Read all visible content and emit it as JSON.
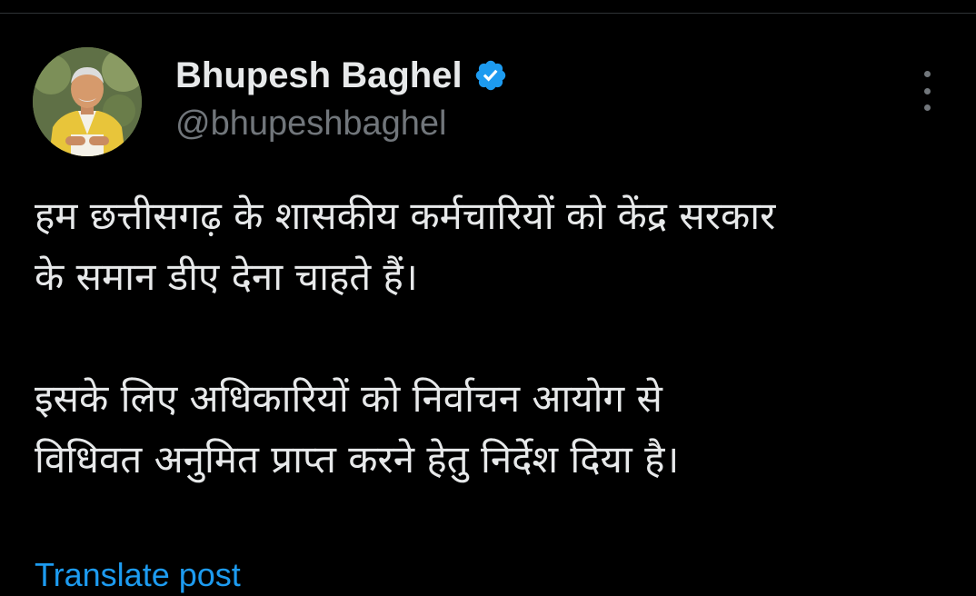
{
  "author": {
    "display_name": "Bhupesh Baghel",
    "handle": "@bhupeshbaghel",
    "verified_icon": "verified-badge-icon",
    "verified_color": "#1d9bf0",
    "avatar_icon": "profile-avatar"
  },
  "menu": {
    "icon": "more-options-icon"
  },
  "tweet": {
    "paragraphs": [
      {
        "lines": [
          "हम छत्तीसगढ़ के शासकीय कर्मचारियों को केंद्र सरकार",
          "के समान डीए देना चाहते हैं।"
        ]
      },
      {
        "lines": [
          "इसके लिए अधिकारियों को निर्वाचन आयोग से",
          "विधिवत अनुमित प्राप्त करने हेतु निर्देश दिया है।"
        ]
      }
    ]
  },
  "translate": {
    "label": "Translate post",
    "color": "#1d9bf0"
  },
  "colors": {
    "background": "#000000",
    "text": "#e7e9ea",
    "secondary_text": "#71767b",
    "accent": "#1d9bf0"
  }
}
